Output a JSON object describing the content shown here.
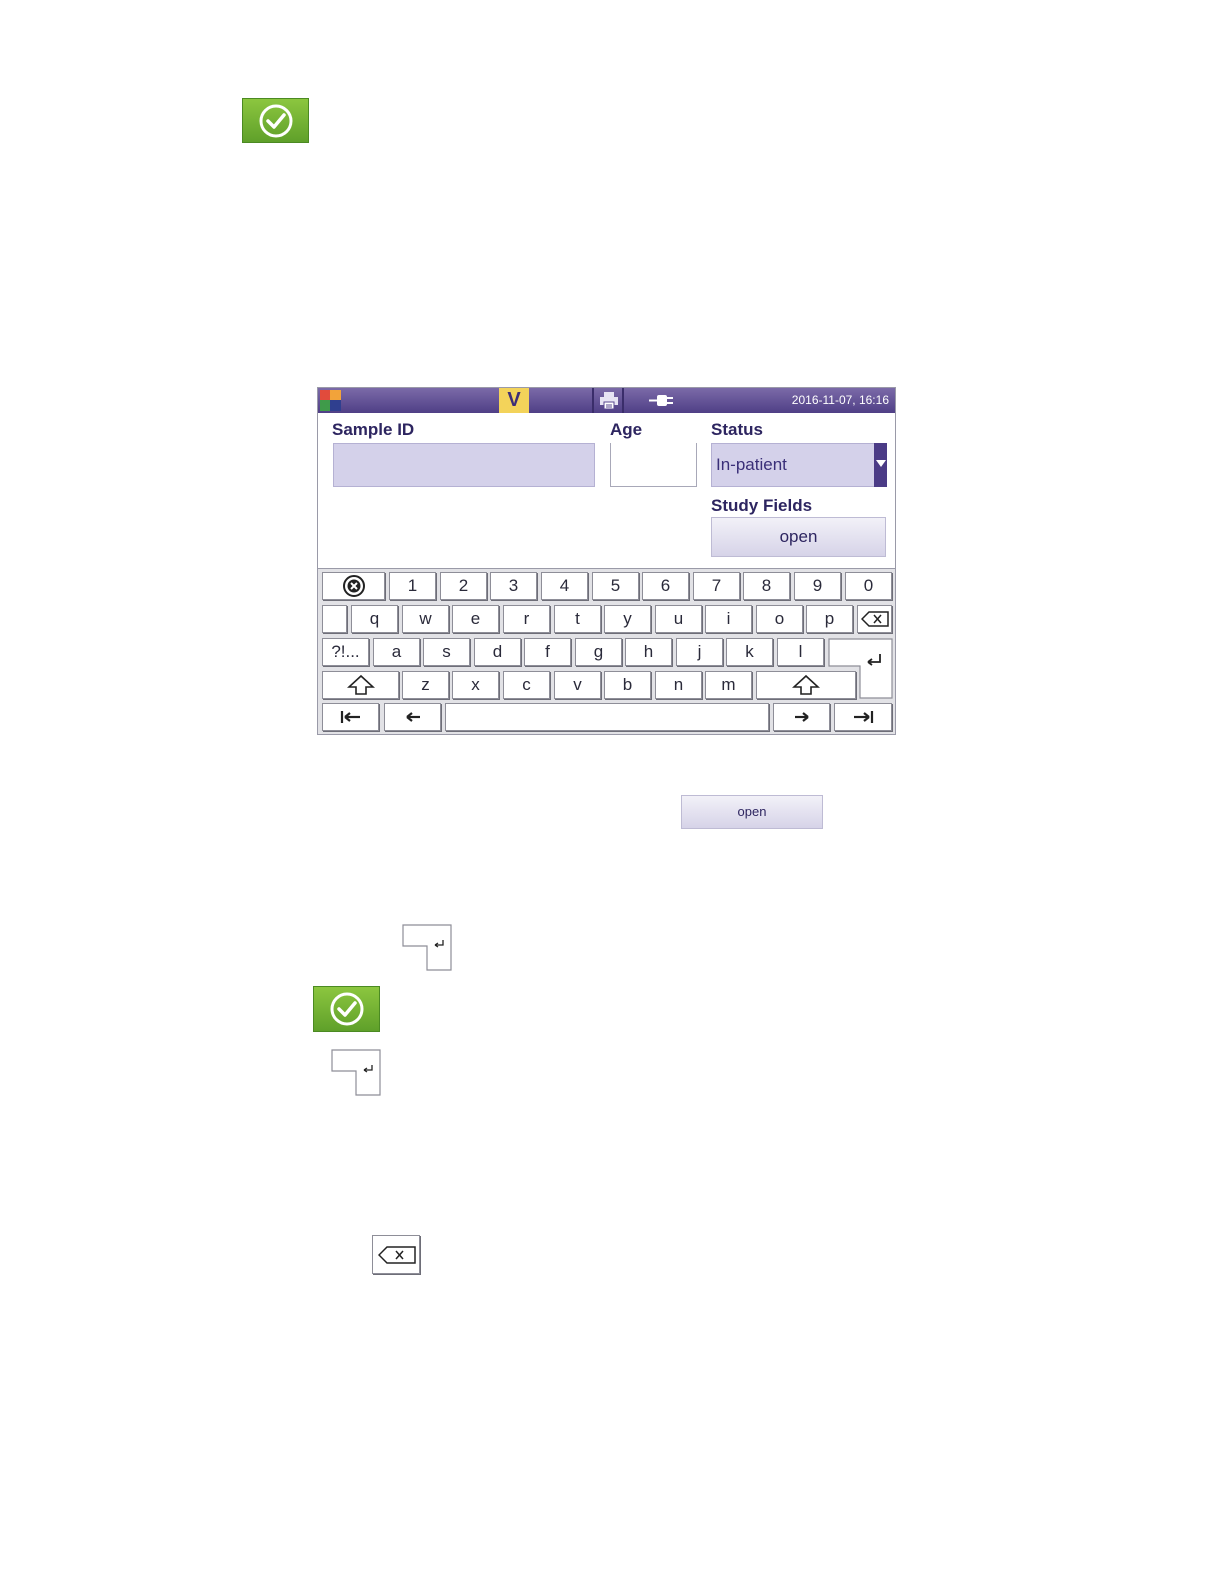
{
  "statusbar": {
    "badge": "V",
    "datetime": "2016-11-07, 16:16"
  },
  "form": {
    "sample_id_label": "Sample ID",
    "age_label": "Age",
    "status_label": "Status",
    "status_value": "In-patient",
    "study_fields_label": "Study Fields",
    "open_label": "open"
  },
  "keyboard": {
    "row1": [
      "1",
      "2",
      "3",
      "4",
      "5",
      "6",
      "7",
      "8",
      "9",
      "0"
    ],
    "row2": [
      "q",
      "w",
      "e",
      "r",
      "t",
      "y",
      "u",
      "i",
      "o",
      "p"
    ],
    "row3": [
      "a",
      "s",
      "d",
      "f",
      "g",
      "h",
      "j",
      "k",
      "l"
    ],
    "row4": [
      "z",
      "x",
      "c",
      "v",
      "b",
      "n",
      "m"
    ],
    "symbols_label": "?!..."
  },
  "doc": {
    "open_button_label": "open"
  },
  "colors": {
    "statusbar_purple": "#4f3f86",
    "accent_yellow": "#f3d35a",
    "field_lavender": "#d4d1ea",
    "confirm_green": "#6aaa30"
  }
}
